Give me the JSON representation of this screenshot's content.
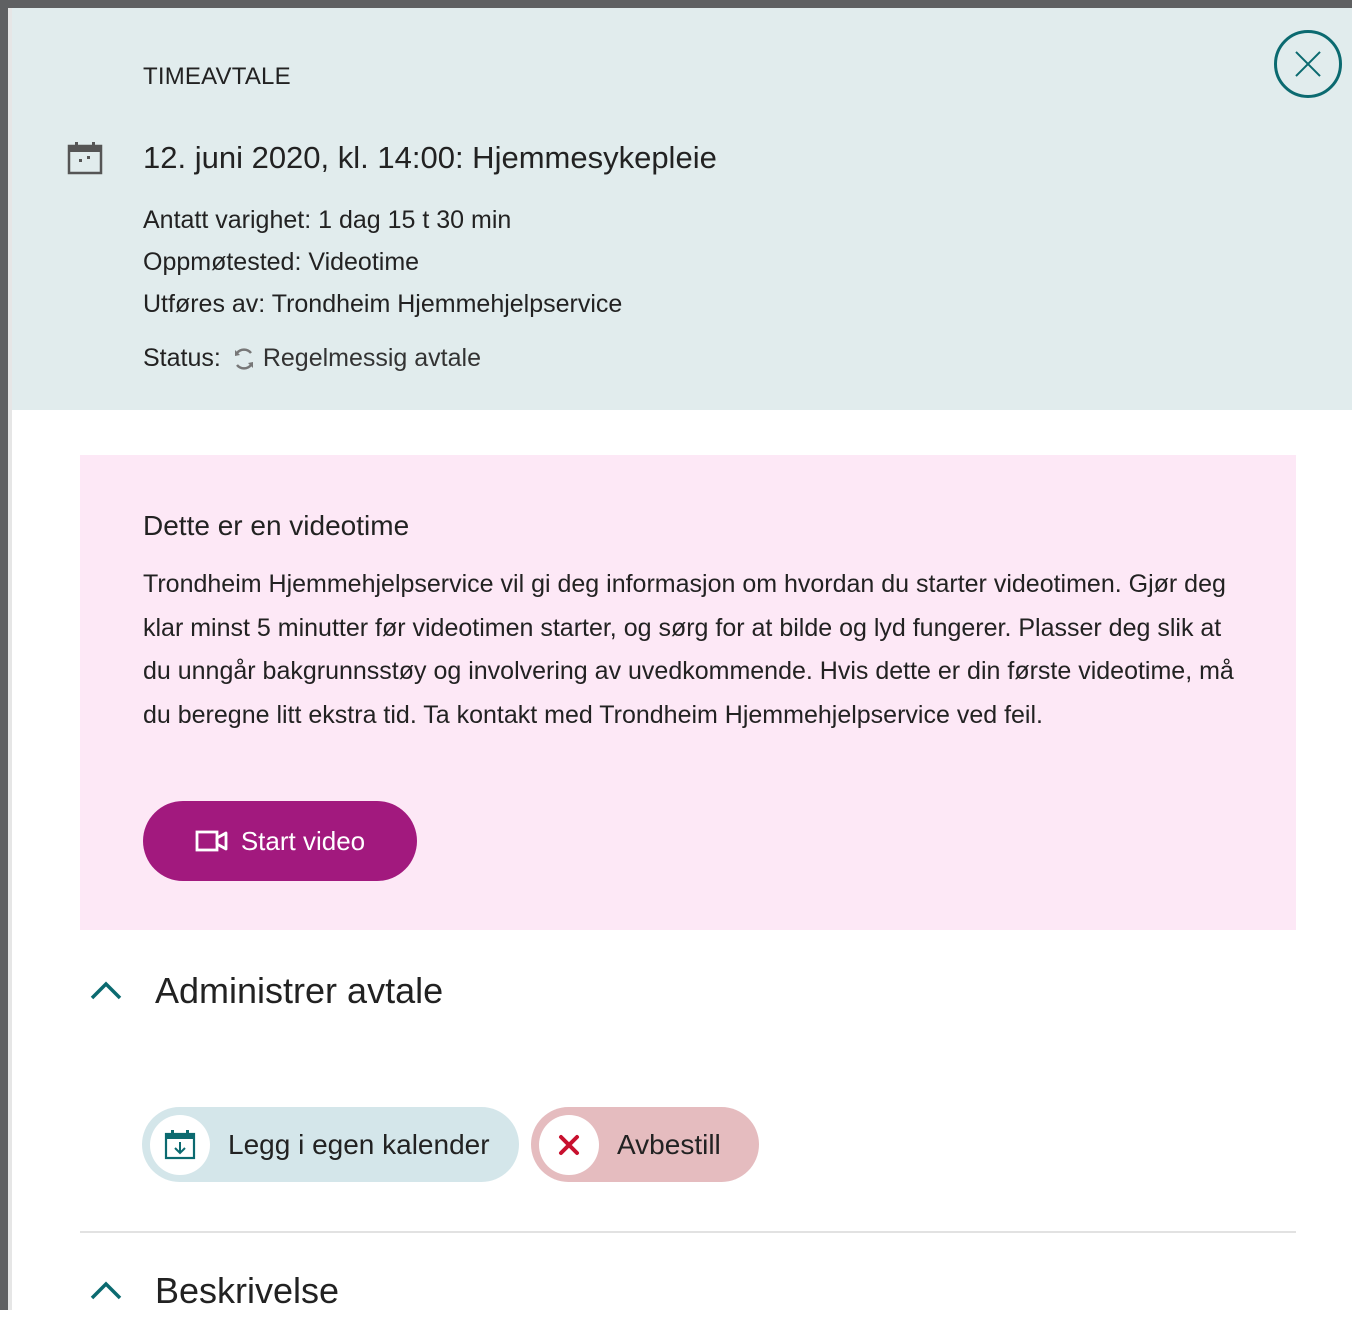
{
  "header": {
    "kicker": "TIMEAVTALE",
    "title": "12. juni 2020, kl. 14:00: Hjemmesykepleie",
    "duration": "Antatt varighet: 1 dag 15 t 30 min",
    "location": "Oppmøtested: Videotime",
    "performed_by": "Utføres av: Trondheim Hjemmehjelpservice",
    "status_label": "Status:",
    "status_value": "Regelmessig avtale",
    "close_icon": "close-icon",
    "calendar_icon": "calendar-icon",
    "status_icon": "repeat-icon"
  },
  "video": {
    "heading": "Dette er en videotime",
    "body": "Trondheim Hjemmehjelpservice vil gi deg informasjon om hvordan du starter videotimen. Gjør deg klar minst 5 minutter før videotimen starter, og sørg for at bilde og lyd fungerer. Plasser deg slik at du unngår bakgrunnsstøy og involvering av uvedkommende. Hvis dette er din første videotime, må du beregne litt ekstra tid. Ta kontakt med Trondheim Hjemmehjelpservice ved feil.",
    "start_label": "Start video",
    "button_icon": "video-camera-icon"
  },
  "manage": {
    "title": "Administrer avtale",
    "add_calendar_label": "Legg i egen kalender",
    "cancel_label": "Avbestill"
  },
  "description": {
    "title": "Beskrivelse"
  },
  "colors": {
    "header_bg": "#e1eced",
    "accent_teal": "#0b6a70",
    "video_box_bg": "#fde8f6",
    "video_button": "#a2197e",
    "calendar_pill": "#d4e6ea",
    "cancel_pill": "#e5bcbf",
    "cancel_x": "#c8102e"
  }
}
